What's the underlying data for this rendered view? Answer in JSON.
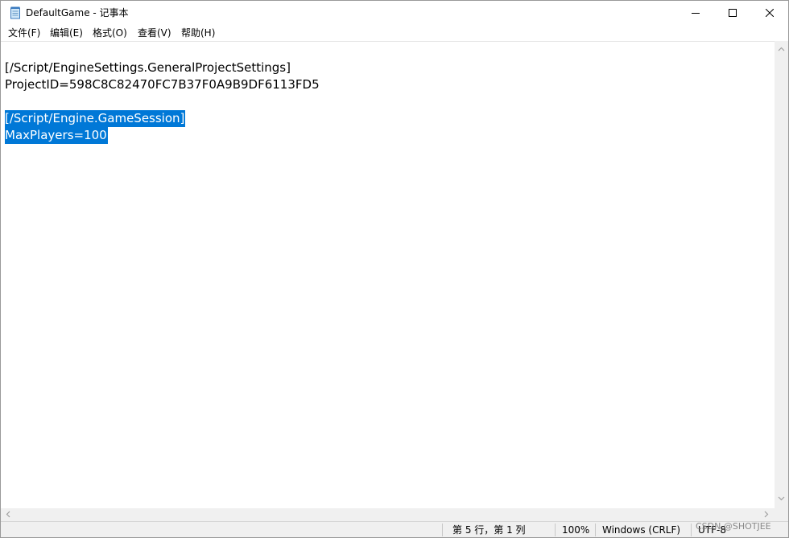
{
  "window": {
    "title": "DefaultGame - 记事本",
    "icon": "notepad-icon",
    "controls": {
      "minimize": "minimize-icon",
      "maximize": "maximize-icon",
      "close": "close-icon"
    }
  },
  "menu": {
    "file": "文件(F)",
    "edit": "编辑(E)",
    "format": "格式(O)",
    "view": "查看(V)",
    "help": "帮助(H)"
  },
  "editor": {
    "lines": [
      "[/Script/EngineSettings.GeneralProjectSettings]",
      "ProjectID=598C8C82470FC7B37F0A9B9DF6113FD5",
      "",
      "[/Script/Engine.GameSession]",
      "MaxPlayers=100"
    ],
    "selection_color": "#0078d7"
  },
  "status": {
    "position": "第 5 行，第 1 列",
    "zoom": "100%",
    "line_ending": "Windows (CRLF)",
    "encoding": "UTF-8"
  },
  "watermark": "CSDN @SHOTJEE"
}
